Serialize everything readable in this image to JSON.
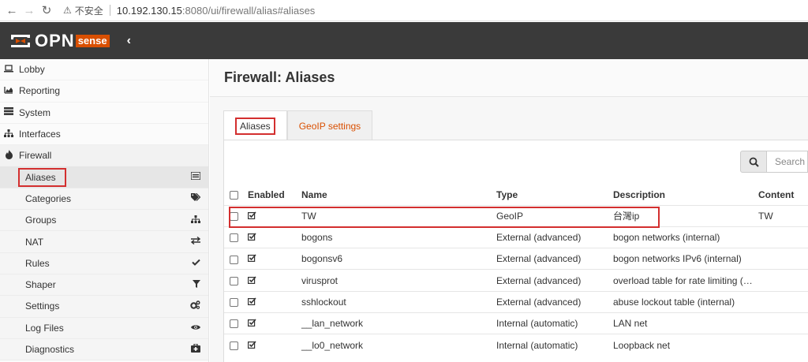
{
  "browser": {
    "insecure_label": "不安全",
    "url_host": "10.192.130.15",
    "url_rest": ":8080/ui/firewall/alias#aliases"
  },
  "header": {
    "logo_text": "OPN",
    "logo_sense": "sense"
  },
  "sidebar": {
    "items": [
      {
        "label": "Lobby",
        "icon": "laptop-icon"
      },
      {
        "label": "Reporting",
        "icon": "area-chart-icon"
      },
      {
        "label": "System",
        "icon": "server-icon"
      },
      {
        "label": "Interfaces",
        "icon": "sitemap-icon"
      },
      {
        "label": "Firewall",
        "icon": "fire-icon"
      }
    ],
    "firewall_sub": [
      {
        "label": "Aliases",
        "icon": "list-icon"
      },
      {
        "label": "Categories",
        "icon": "tags-icon"
      },
      {
        "label": "Groups",
        "icon": "sitemap-icon"
      },
      {
        "label": "NAT",
        "icon": "exchange-icon"
      },
      {
        "label": "Rules",
        "icon": "check-icon"
      },
      {
        "label": "Shaper",
        "icon": "filter-icon"
      },
      {
        "label": "Settings",
        "icon": "cogs-icon"
      },
      {
        "label": "Log Files",
        "icon": "eye-icon"
      },
      {
        "label": "Diagnostics",
        "icon": "medkit-icon"
      }
    ]
  },
  "main": {
    "title": "Firewall: Aliases",
    "tabs": [
      {
        "label": "Aliases",
        "active": true
      },
      {
        "label": "GeoIP settings",
        "active": false
      }
    ],
    "search_placeholder": "Search",
    "columns": [
      "Enabled",
      "Name",
      "Type",
      "Description",
      "Content"
    ],
    "rows": [
      {
        "enabled": true,
        "name": "TW",
        "type": "GeoIP",
        "description": "台灣ip",
        "content": "TW"
      },
      {
        "enabled": true,
        "name": "bogons",
        "type": "External (advanced)",
        "description": "bogon networks (internal)",
        "content": ""
      },
      {
        "enabled": true,
        "name": "bogonsv6",
        "type": "External (advanced)",
        "description": "bogon networks IPv6 (internal)",
        "content": ""
      },
      {
        "enabled": true,
        "name": "virusprot",
        "type": "External (advanced)",
        "description": "overload table for rate limiting (…",
        "content": ""
      },
      {
        "enabled": true,
        "name": "sshlockout",
        "type": "External (advanced)",
        "description": "abuse lockout table (internal)",
        "content": ""
      },
      {
        "enabled": true,
        "name": "__lan_network",
        "type": "Internal (automatic)",
        "description": "LAN net",
        "content": ""
      },
      {
        "enabled": true,
        "name": "__lo0_network",
        "type": "Internal (automatic)",
        "description": "Loopback net",
        "content": ""
      }
    ]
  }
}
